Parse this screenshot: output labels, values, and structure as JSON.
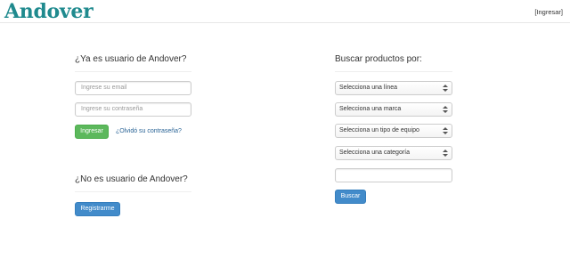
{
  "header": {
    "logo": "Andover",
    "login_link": "[Ingresar]"
  },
  "existing_user": {
    "title": "¿Ya es usuario de Andover?",
    "email_placeholder": "Ingrese su email",
    "password_placeholder": "Ingrese su contraseña",
    "login_button": "Ingresar",
    "forgot_link": "¿Olvidó su contraseña?"
  },
  "new_user": {
    "title": "¿No es usuario de Andover?",
    "register_button": "Registrarme"
  },
  "search": {
    "title": "Buscar productos por:",
    "selects": [
      "Selecciona una línea",
      "Selecciona una marca",
      "Selecciona un tipo de equipo",
      "Selecciona una categoría"
    ],
    "text_value": "",
    "search_button": "Buscar"
  },
  "colors": {
    "logo": "#1f8a8e",
    "success": "#5cb85c",
    "primary": "#428bca",
    "link": "#2a6496"
  }
}
